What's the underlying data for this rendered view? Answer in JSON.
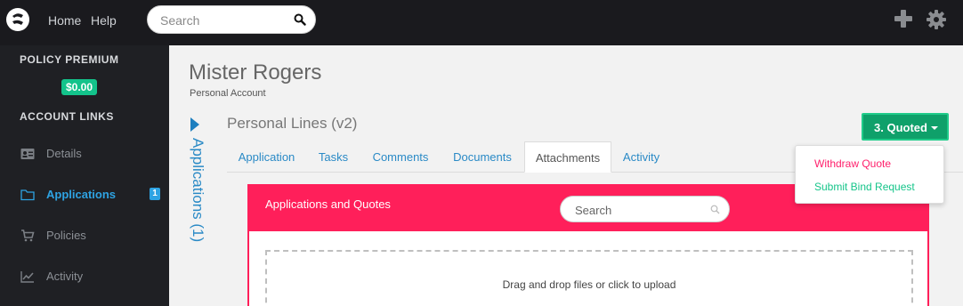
{
  "topbar": {
    "nav": {
      "home": "Home",
      "help": "Help"
    },
    "search_placeholder": "Search"
  },
  "sidebar": {
    "policy_premium_heading": "POLICY PREMIUM",
    "premium_value": "$0.00",
    "account_links_heading": "ACCOUNT LINKS",
    "items": [
      {
        "label": "Details",
        "icon": "id-card-icon"
      },
      {
        "label": "Applications",
        "icon": "folder-icon",
        "active": true,
        "badge": "1"
      },
      {
        "label": "Policies",
        "icon": "cart-icon"
      },
      {
        "label": "Activity",
        "icon": "line-chart-icon"
      }
    ]
  },
  "main": {
    "account_name": "Mister Rogers",
    "account_type": "Personal Account",
    "vertical_tab": "Applications (1)",
    "section_title": "Personal Lines (v2)",
    "status_button": "3. Quoted",
    "status_menu": [
      "Withdraw Quote",
      "Submit Bind Request"
    ],
    "tabs": [
      "Application",
      "Tasks",
      "Comments",
      "Documents",
      "Attachments",
      "Activity"
    ],
    "active_tab": "Attachments",
    "panel": {
      "title": "Applications and Quotes",
      "search_placeholder": "Search",
      "dropzone_text": "Drag and drop files or click to upload"
    }
  },
  "colors": {
    "topbar": "#1a1a1e",
    "sidebar": "#1f2024",
    "accent_blue": "#2ea3e3",
    "panel_header": "#ff1f5a",
    "status_green": "#0fa06a",
    "premium_green": "#13c38b"
  }
}
